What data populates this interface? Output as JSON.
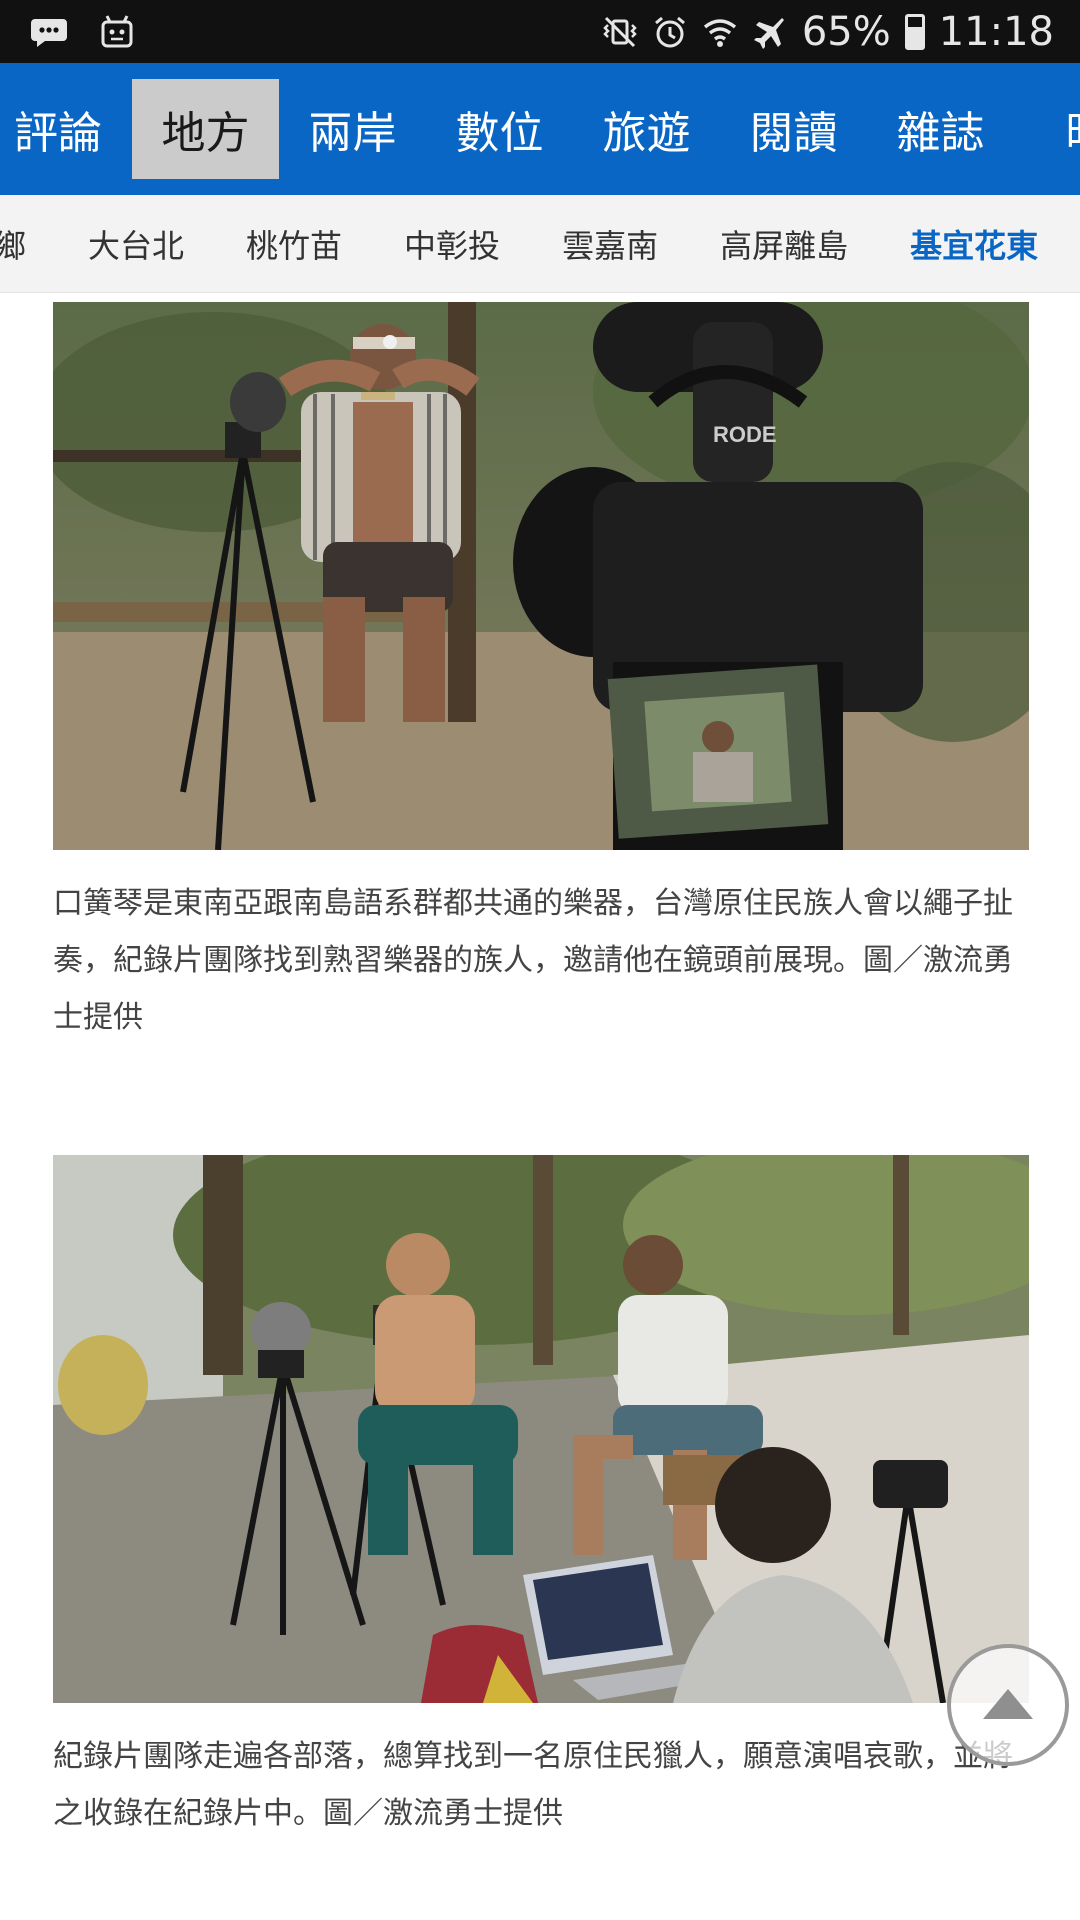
{
  "status_bar": {
    "battery": "65%",
    "time": "11:18",
    "battery_level": 0.65
  },
  "main_tabs": [
    {
      "label": "評論"
    },
    {
      "label": "地方"
    },
    {
      "label": "兩岸"
    },
    {
      "label": "數位"
    },
    {
      "label": "旅遊"
    },
    {
      "label": "閱讀"
    },
    {
      "label": "雜誌"
    },
    {
      "label": "時"
    }
  ],
  "active_main_tab": "地方",
  "sub_tabs": [
    {
      "label": "鄉"
    },
    {
      "label": "大台北"
    },
    {
      "label": "桃竹苗"
    },
    {
      "label": "中彰投"
    },
    {
      "label": "雲嘉南"
    },
    {
      "label": "高屏離島"
    },
    {
      "label": "基宜花東"
    }
  ],
  "active_sub_tab": "基宜花東",
  "article": {
    "photo1_caption": "口簧琴是東南亞跟南島語系群都共通的樂器，台灣原住民族人會以繩子扯奏，紀錄片團隊找到熟習樂器的族人，邀請他在鏡頭前展現。圖／激流勇士提供",
    "photo2_caption": "紀錄片團隊走遍各部落，總算找到一名原住民獵人，願意演唱哀歌，並將之收錄在紀錄片中。圖／激流勇士提供",
    "photo1_camera_brand": "RODE"
  },
  "colors": {
    "header_blue": "#0a66c5",
    "active_tab_bg": "#cbcbcb",
    "active_subtab": "#0a66c5",
    "status_bar": "#111111"
  },
  "icons": [
    "chat-bubble-icon",
    "android-robot-icon",
    "vibrate-mute-icon",
    "alarm-icon",
    "wifi-icon",
    "airplane-icon",
    "battery-icon",
    "arrow-up-icon"
  ]
}
